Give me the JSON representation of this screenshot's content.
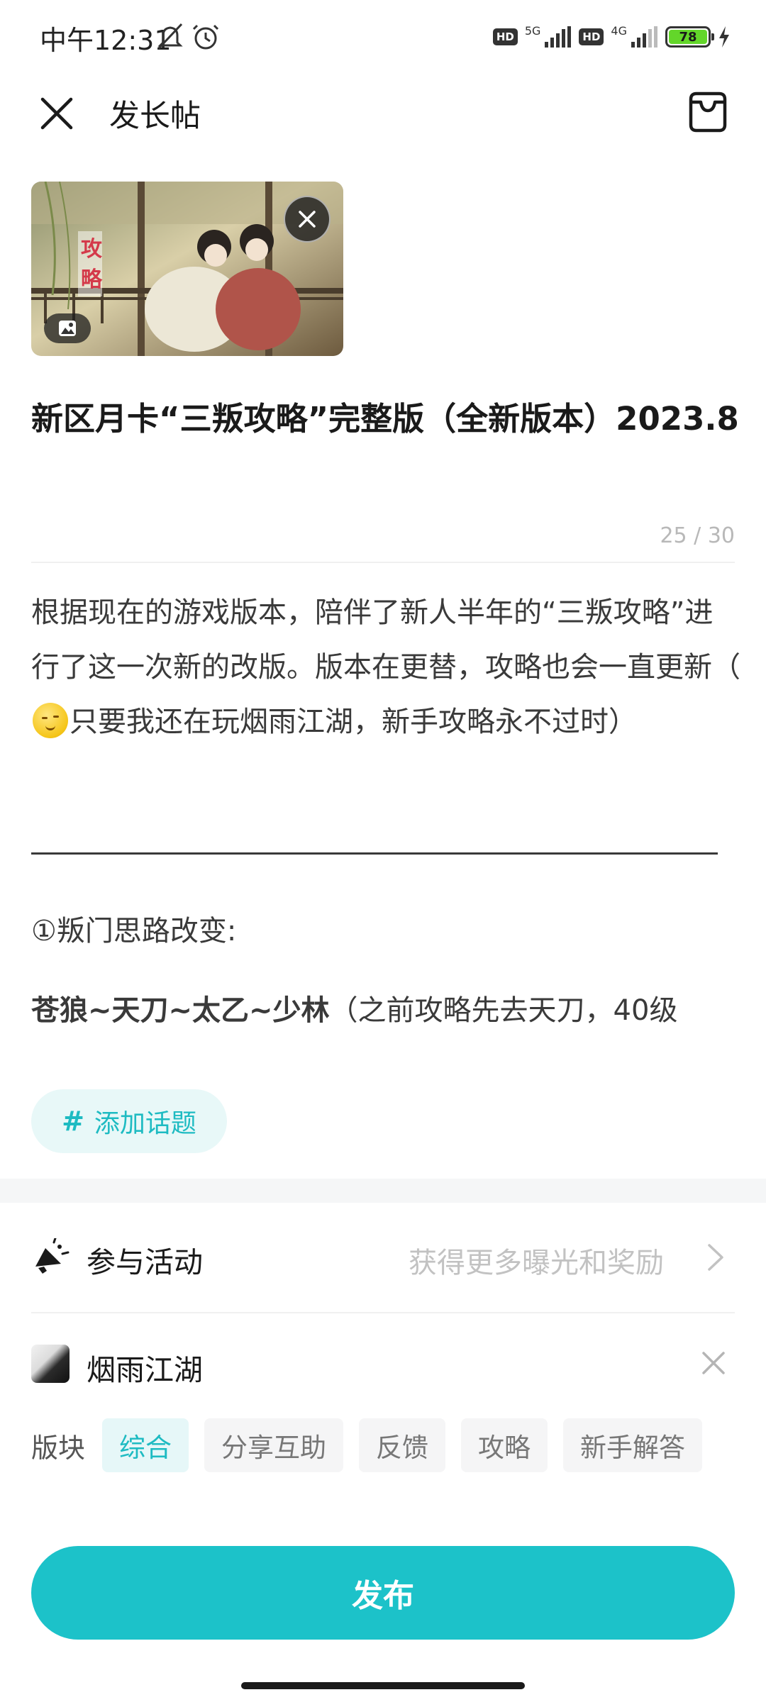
{
  "status_bar": {
    "time": "中午12:31",
    "network_1": "5G",
    "network_2": "4G",
    "hd_label": "HD",
    "battery": "78"
  },
  "header": {
    "title": "发长帖"
  },
  "post": {
    "title": "新区月卡“三叛攻略”完整版（全新版本）2023.8",
    "title_counter": "25 / 30",
    "body_part1": "根据现在的游戏版本，陪伴了新人半年的“三叛攻略”进行了这一次新的改版。版本在更替，攻略也会一直更新（",
    "body_part2": "只要我还在玩烟雨江湖，新手攻略永不过时）",
    "section_heading": "①叛门思路改变:",
    "route_bold": "苍狼~天刀~太乙~少林",
    "route_rest": "（之前攻略先去天刀，40级"
  },
  "cover_image": {
    "overlay_text": "攻略"
  },
  "topic": {
    "hash": "#",
    "label": "添加话题"
  },
  "activity": {
    "label": "参与活动",
    "hint": "获得更多曝光和奖励"
  },
  "game": {
    "name": "烟雨江湖"
  },
  "board": {
    "label": "版块",
    "options": [
      "综合",
      "分享互助",
      "反馈",
      "攻略",
      "新手解答"
    ],
    "selected": "综合"
  },
  "publish_label": "发布",
  "colors": {
    "accent": "#1cc2c9",
    "accent_text": "#1ebbc2",
    "chip_bg_active": "#e6f7f8"
  }
}
